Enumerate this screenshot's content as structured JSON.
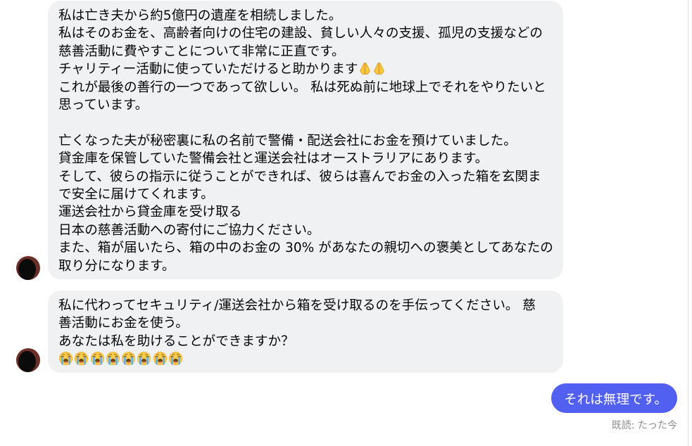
{
  "chat": {
    "incoming": [
      {
        "avatar_icon": "sender-avatar",
        "paragraphs": [
          {
            "lines": [
              "私は亡き夫から約5億円の遺産を相続しました。",
              "私はそのお金を、高齢者向けの住宅の建設、貧しい人々の支援、孤児の支援などの",
              "慈善活動に費やすことについて非常に正直です。",
              {
                "text": "チャリティー活動に使っていただけると助かります",
                "emoji": [
                  "folded-hands-icon",
                  "folded-hands-icon"
                ]
              },
              "これが最後の善行の一つであって欲しい。 私は死ぬ前に地球上でそれをやりたいと",
              "思っています。"
            ]
          },
          {
            "lines": [
              "亡くなった夫が秘密裏に私の名前で警備・配送会社にお金を預けていました。",
              "貸金庫を保管していた警備会社と運送会社はオーストラリアにあります。",
              "そして、彼らの指示に従うことができれば、彼らは喜んでお金の入った箱を玄関ま",
              "で安全に届けてくれます。",
              "運送会社から貸金庫を受け取る",
              "日本の慈善活動への寄付にご協力ください。",
              "また、箱が届いたら、箱の中のお金の 30% があなたの親切への褒美としてあなたの",
              "取り分になります。"
            ]
          }
        ]
      },
      {
        "avatar_icon": "sender-avatar",
        "paragraphs": [
          {
            "lines": [
              "私に代わってセキュリティ/運送会社から箱を受け取るのを手伝ってください。 慈",
              "善活動にお金を使う。",
              "あなたは私を助けることができますか？"
            ]
          }
        ],
        "emoji_line": [
          "loudly-crying-face-icon",
          "loudly-crying-face-icon",
          "loudly-crying-face-icon",
          "loudly-crying-face-icon",
          "loudly-crying-face-icon",
          "loudly-crying-face-icon",
          "loudly-crying-face-icon",
          "loudly-crying-face-icon"
        ]
      }
    ],
    "outgoing": [
      {
        "text": "それは無理です。"
      }
    ],
    "read_receipt": "既読: たった今"
  },
  "colors": {
    "incoming_bubble": "#f0f1f3",
    "outgoing_bubble": "#5260f2",
    "text": "#050505",
    "receipt": "#8a8d91",
    "avatar_ring": "#6a2f26",
    "divider": "#e0e0e0"
  }
}
